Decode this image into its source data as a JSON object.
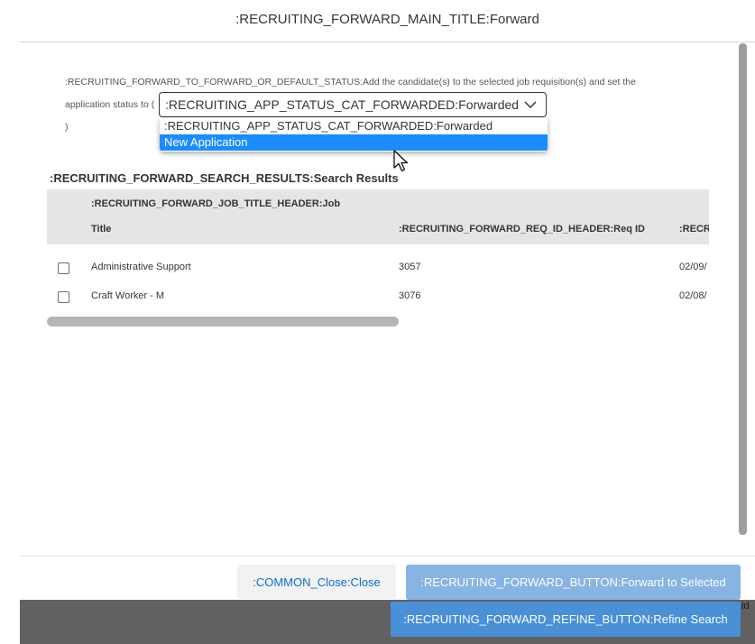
{
  "dialog": {
    "title": ":RECRUITING_FORWARD_MAIN_TITLE:Forward"
  },
  "instructions": {
    "line1": ":RECRUITING_FORWARD_TO_FORWARD_OR_DEFAULT_STATUS:Add the candidate(s) to the selected job requisition(s) and set the",
    "line2_prefix": "application status to (",
    "line3": ")"
  },
  "status_select": {
    "value": ":RECRUITING_APP_STATUS_CAT_FORWARDED:Forwarded",
    "options": [
      ":RECRUITING_APP_STATUS_CAT_FORWARDED:Forwarded",
      "New Application"
    ],
    "highlighted_option": "New Application"
  },
  "results": {
    "title": ":RECRUITING_FORWARD_SEARCH_RESULTS:Search Results",
    "headers": {
      "job_title_line1": ":RECRUITING_FORWARD_JOB_TITLE_HEADER:Job",
      "job_title_line2": "Title",
      "req_id": ":RECRUITING_FORWARD_REQ_ID_HEADER:Req ID",
      "date_truncated": ":RECR"
    },
    "rows": [
      {
        "job_title": "Administrative Support",
        "req_id": "3057",
        "date": "02/09/"
      },
      {
        "job_title": "Craft Worker - M",
        "req_id": "3076",
        "date": "02/08/"
      }
    ]
  },
  "buttons": {
    "close": ":COMMON_Close:Close",
    "forward": ":RECRUITING_FORWARD_BUTTON:Forward to Selected",
    "refine": ":RECRUITING_FORWARD_REFINE_BUTTON:Refine Search"
  },
  "bottom_bar": {
    "clipped_text": "id"
  },
  "icons": {
    "dropdown": "chevron-down-icon",
    "pointer": "mouse-pointer-icon"
  },
  "colors": {
    "accent": "#0a6ed1",
    "highlight": "#1a8cff",
    "forward_button": "#87b4e3",
    "refine_button": "#4a90d6",
    "bottom_bar": "#616161"
  }
}
